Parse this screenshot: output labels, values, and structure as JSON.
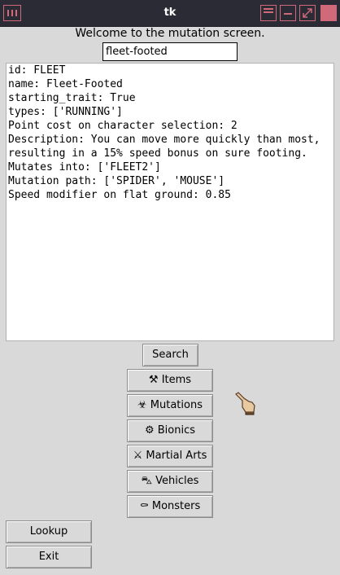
{
  "window": {
    "title": "tk"
  },
  "header": {
    "welcome": "Welcome to the mutation screen."
  },
  "search": {
    "value": "fleet-footed"
  },
  "details": {
    "lines": [
      "id: FLEET",
      "name: Fleet-Footed",
      "starting_trait: True",
      "types: ['RUNNING']",
      "Point cost on character selection: 2",
      "Description: You can move more quickly than most,",
      "resulting in a 15% speed bonus on sure footing.",
      "Mutates into: ['FLEET2']",
      "Mutation path: ['SPIDER', 'MOUSE']",
      "Speed modifier on flat ground: 0.85"
    ]
  },
  "buttons": {
    "search": "Search",
    "items": "⚒ Items",
    "mutations": "☣ Mutations",
    "bionics": "⚙ Bionics",
    "martial_arts": "⚔ Martial Arts",
    "vehicles": "⛍ Vehicles",
    "monsters": "⚰ Monsters",
    "lookup": "Lookup",
    "exit": "Exit"
  }
}
